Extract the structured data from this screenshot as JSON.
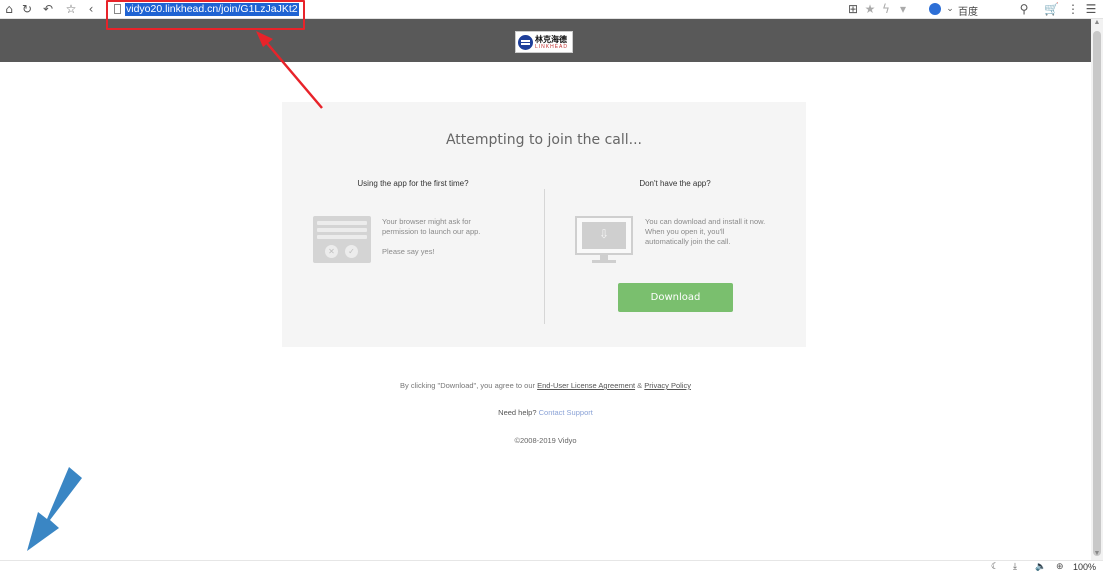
{
  "browser": {
    "url": "vidyo20.linkhead.cn/join/G1LzJaJKt2",
    "search_engine": "百度",
    "zoom": "100%",
    "icons": {
      "home": "home-icon",
      "refresh": "refresh-icon",
      "undo": "undo-icon",
      "bookmark": "star-icon",
      "back": "back-icon",
      "translate": "translate-icon",
      "search": "search-icon",
      "cart": "cart-icon",
      "more": "more-icon",
      "menu": "menu-icon"
    }
  },
  "header": {
    "logo_cn": "林克海德",
    "logo_en": "LINKHEAD"
  },
  "card": {
    "title": "Attempting to join the call...",
    "left": {
      "title": "Using the app for the first time?",
      "text1": "Your browser might ask for",
      "text2": "permission to launch our app.",
      "text3": "Please say yes!"
    },
    "right": {
      "title": "Don't have the app?",
      "text1": "You can download and install it now.",
      "text2": "When you open it, you'll",
      "text3": "automatically join the call.",
      "button": "Download"
    }
  },
  "footer": {
    "agree_prefix": "By clicking \"Download\", you agree to our",
    "eula": "End-User License Agreement",
    "amp": "&",
    "privacy": "Privacy Policy",
    "help_prefix": "Need help?",
    "contact": "Contact Support",
    "copyright": "©2008-2019 Vidyo"
  },
  "colors": {
    "header_bg": "#595959",
    "card_bg": "#f5f5f5",
    "download_button": "#7abf6e",
    "url_highlight": "#1f63d3",
    "annotation_red": "#e8232a",
    "annotation_blue": "#3a86c4"
  }
}
